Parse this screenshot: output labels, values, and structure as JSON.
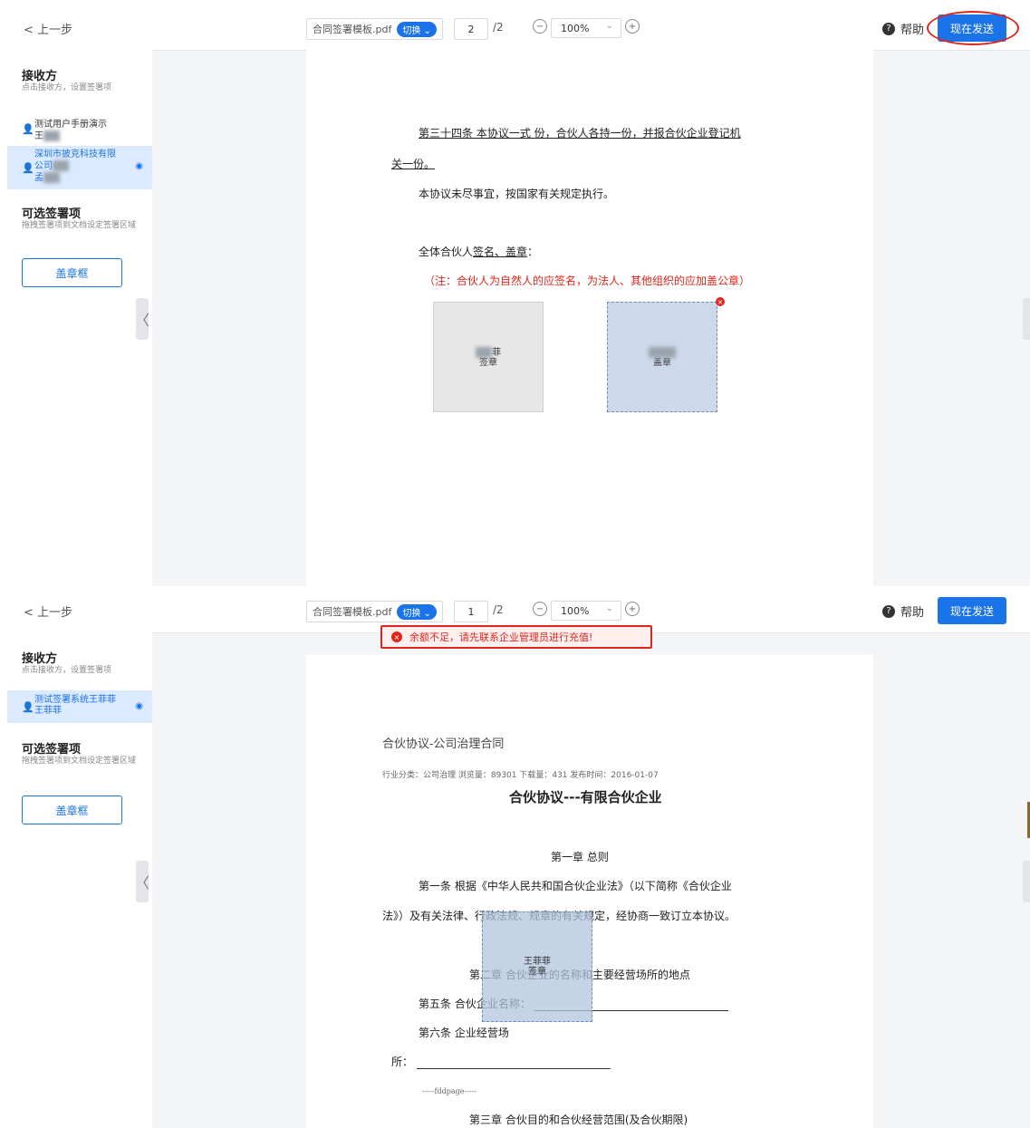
{
  "top_panel": {
    "toolbar": {
      "back_label": "< 上一步",
      "file_name": "合同签署模板.pdf",
      "switch_label": "切换",
      "page_current": "2",
      "page_total": "/2",
      "zoom": "100%",
      "help_label": "帮助",
      "send_label": "现在发送"
    },
    "sidebar": {
      "receiver_title": "接收方",
      "receiver_sub": "点击接收方，设置签署项",
      "receivers": [
        {
          "name": "测试用户手册演示",
          "sub": "王"
        },
        {
          "name": "深圳市披克科技有限",
          "sub": "公司",
          "sub2": "孟"
        }
      ],
      "optional_title": "可选签署项",
      "optional_sub": "拖拽签署项到文档设定签署区域",
      "seal_button": "盖章框"
    },
    "doc": {
      "line1": "第三十四条  本协议一式     份，合伙人各持一份，并报合伙企业登记机",
      "line2": "关一份。",
      "line3": "本协议未尽事宜，按国家有关规定执行。",
      "line4_prefix": "全体合伙人",
      "line4_underlined": "签名、盖章",
      "line4_suffix": "：",
      "note": "（注：合伙人为自然人的应签名，为法人、其他组织的应加盖公章）",
      "sig1_top": "菲",
      "sig1_label": "签章",
      "sig2_label": "盖章"
    }
  },
  "bottom_panel": {
    "toolbar": {
      "back_label": "< 上一步",
      "file_name": "合同签署模板.pdf",
      "switch_label": "切换",
      "page_current": "1",
      "page_total": "/2",
      "zoom": "100%",
      "help_label": "帮助",
      "send_label": "现在发送"
    },
    "toast": "余额不足，请先联系企业管理员进行充值!",
    "sidebar": {
      "receiver_title": "接收方",
      "receiver_sub": "点击接收方，设置签署项",
      "receivers": [
        {
          "name": "测试签署系统王菲菲",
          "sub": "王菲菲"
        }
      ],
      "optional_title": "可选签署项",
      "optional_sub": "拖拽签署项到文档设定签署区域",
      "seal_button": "盖章框"
    },
    "doc": {
      "doc_title": "合伙协议-公司治理合同",
      "meta": "行业分类：公司治理 浏览量：89301 下载量：431 发布时间：2016-01-07",
      "heading": "合伙协议---有限合伙企业",
      "chapter1": "第一章  总则",
      "art1_a": "第一条   根据《中华人民共和国合伙企业法》（以下简称《合伙企业",
      "art1_b": "法》）及有关法律、行政法规、规章的有关规定，经协商一致订立本协议。",
      "chapter2": "第二章   合伙企业的名称和主要经营场所的地点",
      "art5": "第五条   合伙企业名称：",
      "art6": "第六条   企业经营场",
      "art6_b": "所：",
      "fdd": "-----fddpage-----",
      "chapter3": "第三章   合伙目的和合伙经营范围(及合伙期限)",
      "sig_name": "王菲菲",
      "sig_label": "签章"
    }
  }
}
